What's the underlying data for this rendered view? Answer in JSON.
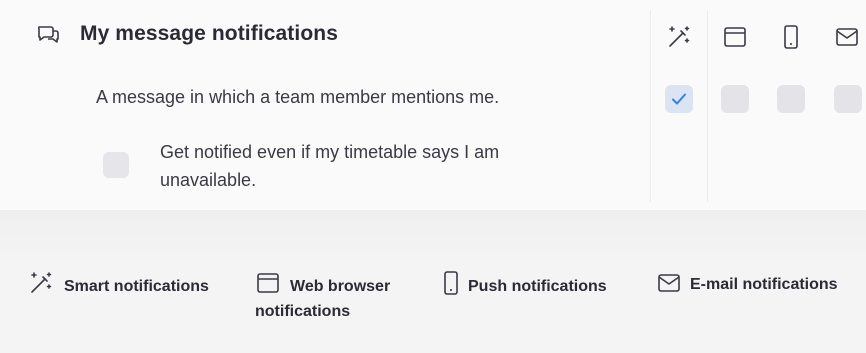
{
  "section": {
    "title": "My message notifications",
    "description": "A message in which a team member mentions me.",
    "override_label": "Get notified even if my timetable says I am unavailable.",
    "override_checked": false
  },
  "columns": [
    {
      "name": "smart",
      "icon": "magic-wand-icon",
      "checked": true
    },
    {
      "name": "web-browser",
      "icon": "browser-window-icon",
      "checked": false
    },
    {
      "name": "push",
      "icon": "phone-icon",
      "checked": false
    },
    {
      "name": "email",
      "icon": "envelope-icon",
      "checked": false
    }
  ],
  "legend": {
    "smart": "Smart notifications",
    "web_browser": "Web browser notifications",
    "push": "Push notifications",
    "email": "E-mail notifications"
  },
  "colors": {
    "check_accent": "#3b7de3",
    "checked_bg": "#dbe4f2",
    "unchecked_bg": "#e4e4e8"
  }
}
